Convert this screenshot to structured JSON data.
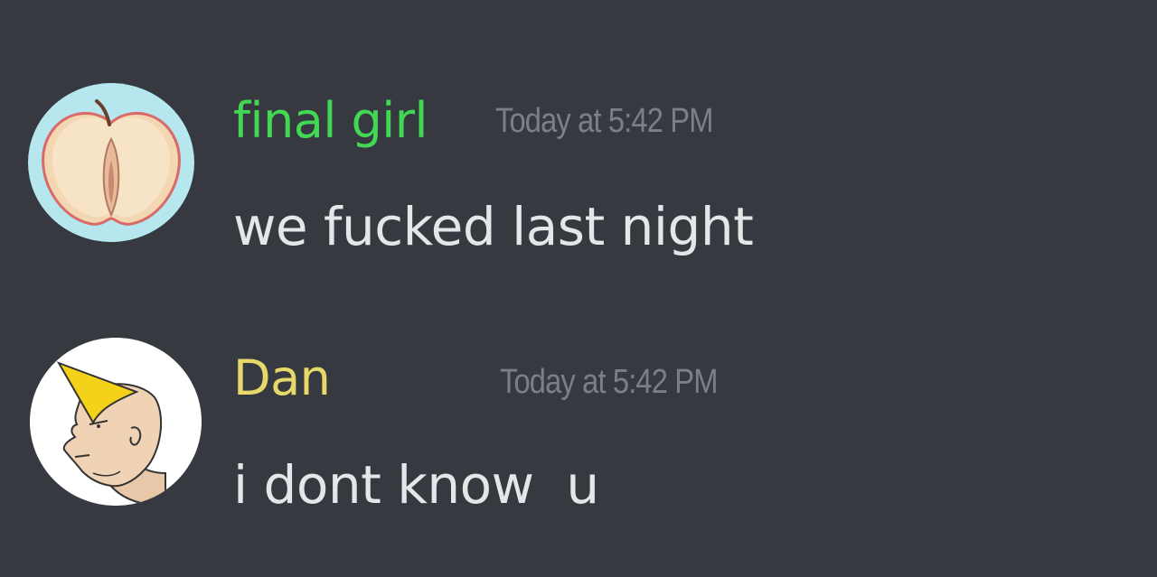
{
  "messages": [
    {
      "username": "final girl",
      "username_color": "#43d854",
      "timestamp": "Today at 5:42 PM",
      "content": "we fucked last night",
      "avatar_icon": "apple-icon"
    },
    {
      "username": "Dan",
      "username_color": "#e6d96a",
      "timestamp": "Today at 5:42 PM",
      "content": "i dont know  u",
      "avatar_icon": "chad-face-icon"
    }
  ]
}
